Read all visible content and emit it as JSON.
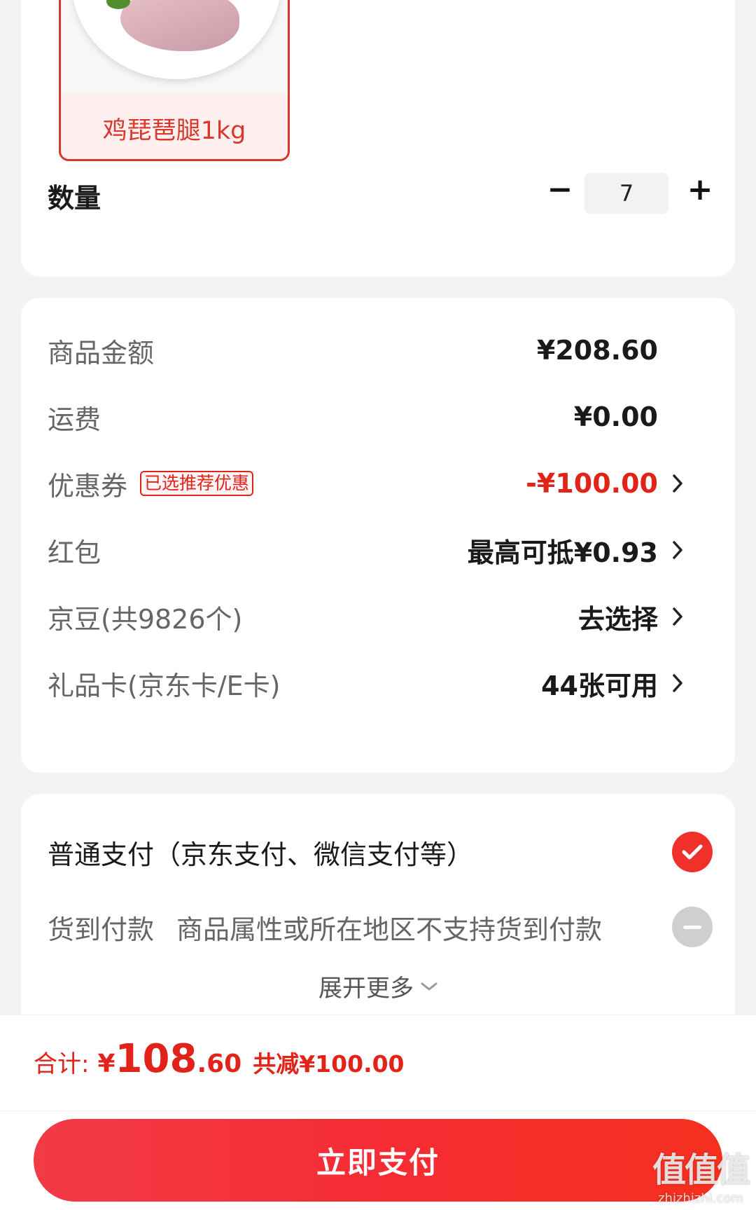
{
  "product": {
    "variant_label": "鸡琵琶腿1kg"
  },
  "quantity": {
    "label": "数量",
    "minus": "−",
    "value": "7",
    "plus": "+"
  },
  "summary": {
    "goods_amount_label": "商品金额",
    "goods_amount_value": "¥208.60",
    "shipping_label": "运费",
    "shipping_value": "¥0.00",
    "coupon_label": "优惠券",
    "coupon_tag": "已选推荐优惠",
    "coupon_value": "-¥100.00",
    "redpacket_label": "红包",
    "redpacket_value": "最高可抵¥0.93",
    "jingdou_label": "京豆(共9826个)",
    "jingdou_value": "去选择",
    "giftcard_label": "礼品卡(京东卡/E卡)",
    "giftcard_value": "44张可用"
  },
  "payment": {
    "normal_label": "普通支付（京东支付、微信支付等）",
    "cod_label": "货到付款",
    "cod_note": "商品属性或所在地区不支持货到付款",
    "expand_label": "展开更多"
  },
  "footer": {
    "total_label": "合计:",
    "total_currency": "¥",
    "total_integer": "108",
    "total_decimal": ".60",
    "total_saving": "共减¥100.00",
    "pay_button": "立即支付"
  },
  "watermark": {
    "main": "值值值",
    "sub": "zhizhizhi.com"
  },
  "colors": {
    "accent_red": "#e2231a",
    "button_red": "#f52c33",
    "background": "#f3f3f3"
  },
  "icons": [
    "chevron-right-icon",
    "check-icon",
    "disabled-icon",
    "chevron-down-icon"
  ]
}
